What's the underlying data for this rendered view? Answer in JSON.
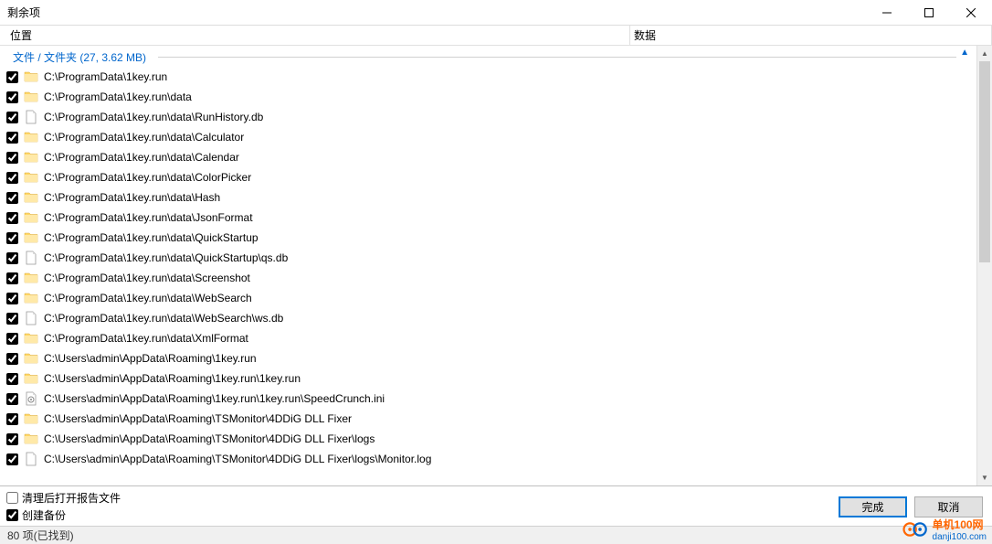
{
  "window": {
    "title": "剩余项"
  },
  "columns": {
    "location": "位置",
    "data": "数据"
  },
  "group": {
    "label": "文件 / 文件夹 (27, 3.62 MB)"
  },
  "items": [
    {
      "type": "folder",
      "path": "C:\\ProgramData\\1key.run"
    },
    {
      "type": "folder",
      "path": "C:\\ProgramData\\1key.run\\data"
    },
    {
      "type": "file",
      "path": "C:\\ProgramData\\1key.run\\data\\RunHistory.db"
    },
    {
      "type": "folder",
      "path": "C:\\ProgramData\\1key.run\\data\\Calculator"
    },
    {
      "type": "folder",
      "path": "C:\\ProgramData\\1key.run\\data\\Calendar"
    },
    {
      "type": "folder",
      "path": "C:\\ProgramData\\1key.run\\data\\ColorPicker"
    },
    {
      "type": "folder",
      "path": "C:\\ProgramData\\1key.run\\data\\Hash"
    },
    {
      "type": "folder",
      "path": "C:\\ProgramData\\1key.run\\data\\JsonFormat"
    },
    {
      "type": "folder",
      "path": "C:\\ProgramData\\1key.run\\data\\QuickStartup"
    },
    {
      "type": "file",
      "path": "C:\\ProgramData\\1key.run\\data\\QuickStartup\\qs.db"
    },
    {
      "type": "folder",
      "path": "C:\\ProgramData\\1key.run\\data\\Screenshot"
    },
    {
      "type": "folder",
      "path": "C:\\ProgramData\\1key.run\\data\\WebSearch"
    },
    {
      "type": "file",
      "path": "C:\\ProgramData\\1key.run\\data\\WebSearch\\ws.db"
    },
    {
      "type": "folder",
      "path": "C:\\ProgramData\\1key.run\\data\\XmlFormat"
    },
    {
      "type": "folder",
      "path": "C:\\Users\\admin\\AppData\\Roaming\\1key.run"
    },
    {
      "type": "folder",
      "path": "C:\\Users\\admin\\AppData\\Roaming\\1key.run\\1key.run"
    },
    {
      "type": "ini",
      "path": "C:\\Users\\admin\\AppData\\Roaming\\1key.run\\1key.run\\SpeedCrunch.ini"
    },
    {
      "type": "folder",
      "path": "C:\\Users\\admin\\AppData\\Roaming\\TSMonitor\\4DDiG DLL Fixer"
    },
    {
      "type": "folder",
      "path": "C:\\Users\\admin\\AppData\\Roaming\\TSMonitor\\4DDiG DLL Fixer\\logs"
    },
    {
      "type": "file",
      "path": "C:\\Users\\admin\\AppData\\Roaming\\TSMonitor\\4DDiG DLL Fixer\\logs\\Monitor.log"
    }
  ],
  "options": {
    "open_report": "清理后打开报告文件",
    "create_backup": "创建备份"
  },
  "buttons": {
    "finish": "完成",
    "cancel": "取消"
  },
  "status": "80 项(已找到)",
  "watermark": {
    "text1": "单机100网",
    "text2": "danji100.com"
  }
}
